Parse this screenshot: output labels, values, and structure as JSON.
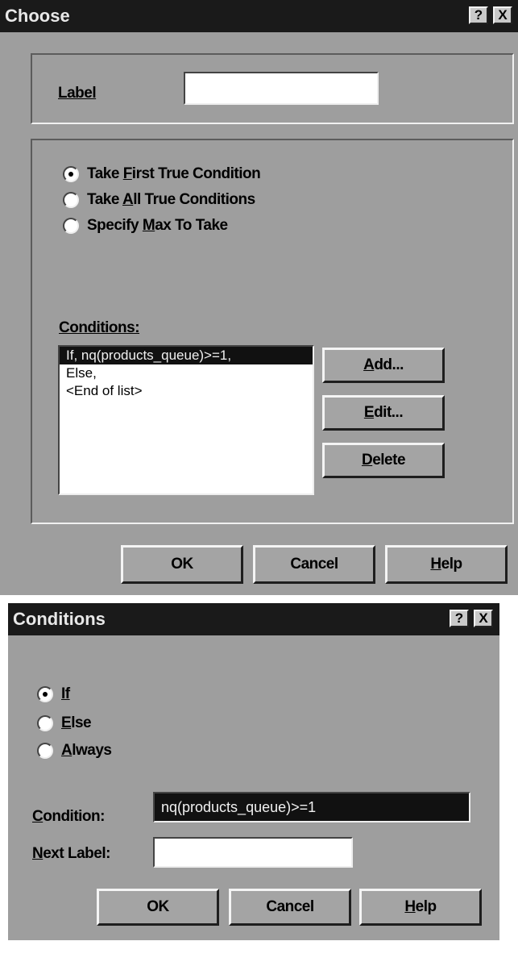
{
  "choose": {
    "title": "Choose",
    "help_glyph": "?",
    "close_glyph": "X",
    "label_caption": "Label",
    "label_value": "",
    "radios": [
      {
        "pre": "Take ",
        "key": "F",
        "post": "irst True Condition",
        "selected": true
      },
      {
        "pre": "Take ",
        "key": "A",
        "post": "ll True Conditions",
        "selected": false
      },
      {
        "pre": "Specify ",
        "key": "M",
        "post": "ax To Take",
        "selected": false
      }
    ],
    "conditions_caption": "Conditions:",
    "conditions": [
      {
        "text": "If, nq(products_queue)>=1,",
        "selected": true
      },
      {
        "text": "Else,",
        "selected": false
      },
      {
        "text": "<End of list>",
        "selected": false
      }
    ],
    "side_buttons": [
      {
        "key": "A",
        "rest": "dd..."
      },
      {
        "key": "E",
        "rest": "dit..."
      },
      {
        "key": "D",
        "rest": "elete"
      }
    ],
    "ok": "OK",
    "cancel": "Cancel",
    "help_key": "H",
    "help_rest": "elp"
  },
  "conditions_dialog": {
    "title": "Conditions",
    "help_glyph": "?",
    "close_glyph": "X",
    "radios": [
      {
        "key": "If",
        "rest": "",
        "selected": true
      },
      {
        "key": "E",
        "rest": "lse",
        "selected": false
      },
      {
        "key": "A",
        "rest": "lways",
        "selected": false
      }
    ],
    "condition_key": "C",
    "condition_rest": "ondition:",
    "condition_value": "nq(products_queue)>=1",
    "next_key": "N",
    "next_rest": "ext Label:",
    "next_value": "",
    "ok": "OK",
    "cancel": "Cancel",
    "help_key": "H",
    "help_rest": "elp"
  }
}
